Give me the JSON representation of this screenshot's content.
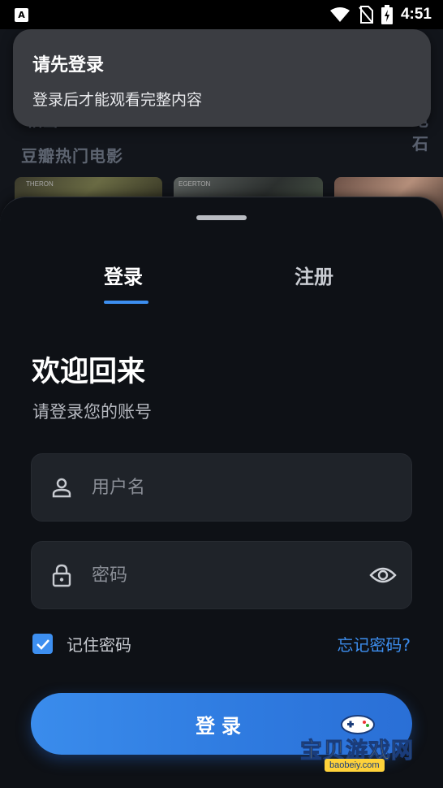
{
  "status_bar": {
    "app_badge": "A",
    "time": "4:51"
  },
  "background": {
    "faded_left": "相当",
    "faded_right": "电石",
    "section_title": "豆瓣热门电影",
    "posters": [
      {
        "caption": "THERON"
      },
      {
        "caption": "EGERTON"
      },
      {
        "caption": ""
      }
    ]
  },
  "toast": {
    "title": "请先登录",
    "message": "登录后才能观看完整内容"
  },
  "sheet": {
    "tabs": [
      {
        "label": "登录",
        "active": true
      },
      {
        "label": "注册",
        "active": false
      }
    ],
    "welcome": "欢迎回来",
    "subtitle": "请登录您的账号",
    "username": {
      "placeholder": "用户名",
      "value": ""
    },
    "password": {
      "placeholder": "密码",
      "value": ""
    },
    "remember_label": "记住密码",
    "remember_checked": true,
    "forgot_label": "忘记密码?",
    "login_button": "登录"
  },
  "watermark": {
    "name": "宝贝游戏网",
    "url": "baobeiy.com"
  },
  "colors": {
    "accent": "#3d8ff0",
    "sheet_bg": "#0e1116",
    "field_bg": "#1f2329",
    "toast_bg": "#3b3d42"
  }
}
